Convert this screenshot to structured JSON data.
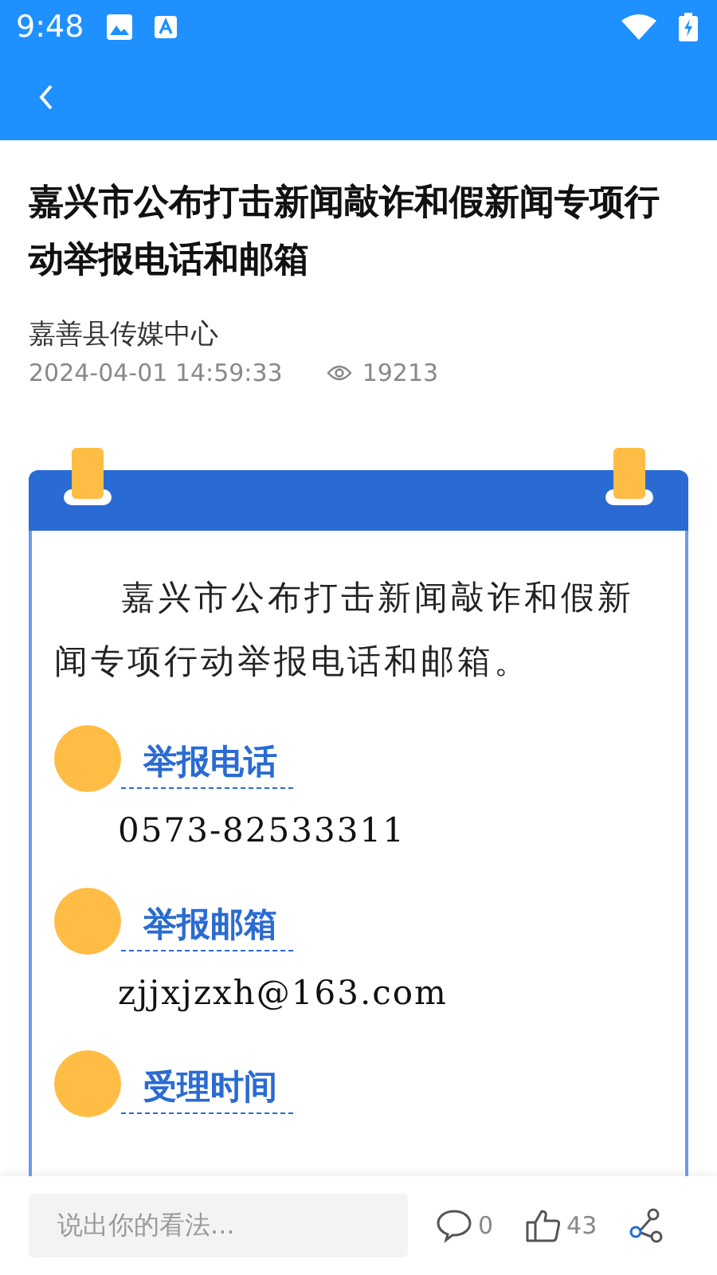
{
  "status_bar": {
    "time": "9:48"
  },
  "article": {
    "title": "嘉兴市公布打击新闻敲诈和假新闻专项行动举报电话和邮箱",
    "source": "嘉善县传媒中心",
    "date": "2024-04-01 14:59:33",
    "views": "19213"
  },
  "card": {
    "intro": "嘉兴市公布打击新闻敲诈和假新闻专项行动举报电话和邮箱。",
    "sections": [
      {
        "heading": "举报电话",
        "value": "0573-82533311"
      },
      {
        "heading": "举报邮箱",
        "value": "zjjxjzxh@163.com"
      },
      {
        "heading": "受理时间"
      }
    ]
  },
  "bottom_bar": {
    "comment_placeholder": "说出你的看法...",
    "comments": "0",
    "likes": "43"
  }
}
